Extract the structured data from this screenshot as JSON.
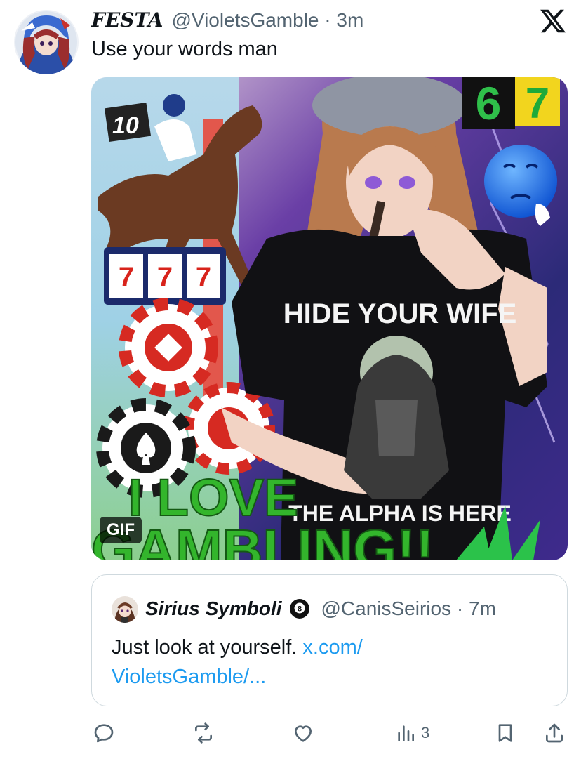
{
  "tweet": {
    "display_name": "FESTA",
    "handle": "@VioletsGamble",
    "separator": "·",
    "time": "3m",
    "text": "Use your words man"
  },
  "media": {
    "badge": "GIF",
    "overlay_texts": {
      "shirt_top": "HIDE YOUR WIFE",
      "shirt_bottom": "THE ALPHA IS HERE",
      "slot_symbols": [
        "7",
        "7",
        "7"
      ],
      "corner_numbers": [
        "6",
        "7"
      ],
      "jockey_number": "10",
      "caption_line1": "I LOVE",
      "caption_line2": "GAMBLING!!"
    }
  },
  "quoted_tweet": {
    "display_name": "Sirius Symboli",
    "badge_icon": "eight-ball-icon",
    "badge_text": "8",
    "handle": "@CanisSeirios",
    "separator": "·",
    "time": "7m",
    "text": "Just look at yourself.",
    "link_line1": "x.com/",
    "link_line2": "VioletsGamble/..."
  },
  "actions": {
    "reply_icon": "reply-icon",
    "retweet_icon": "retweet-icon",
    "like_icon": "heart-icon",
    "views_icon": "views-icon",
    "views_count": "3",
    "bookmark_icon": "bookmark-icon",
    "share_icon": "share-icon"
  },
  "colors": {
    "accent": "#1d9bf0",
    "secondary_text": "#536471",
    "border": "#cfd9de",
    "primary_text": "#0f1419"
  }
}
